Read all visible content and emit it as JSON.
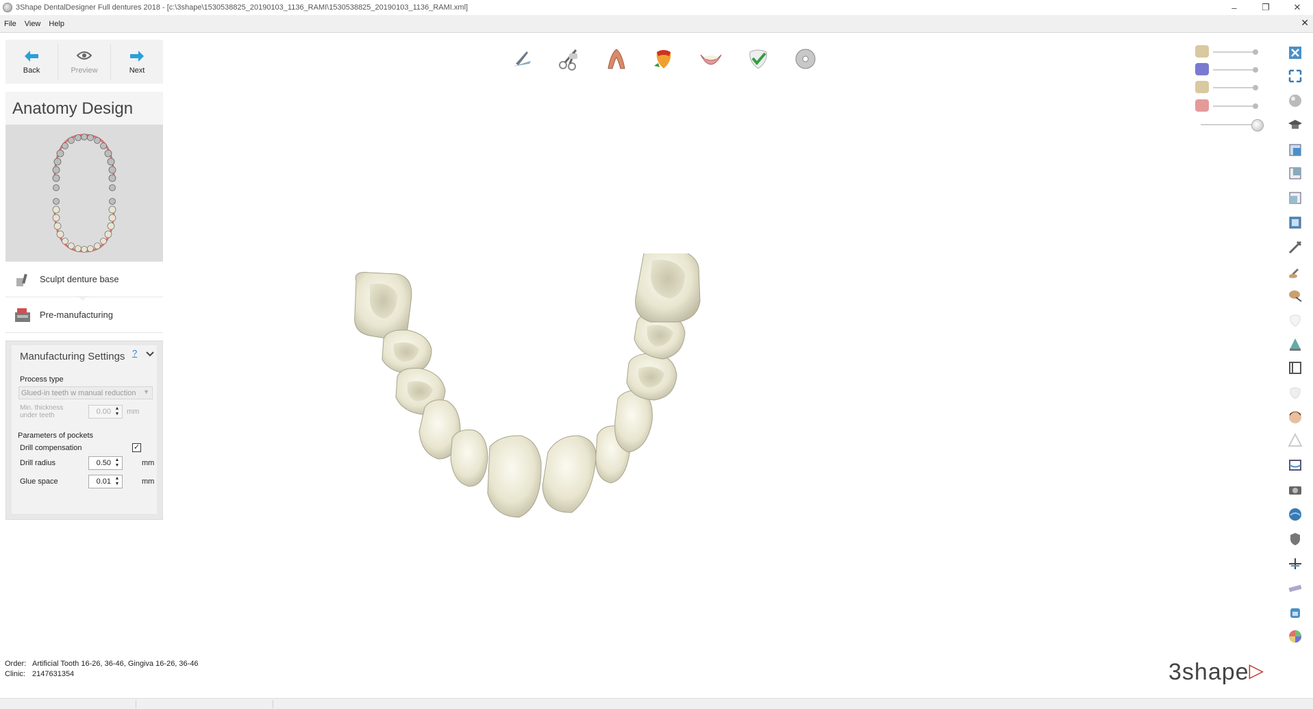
{
  "window": {
    "title": "3Shape DentalDesigner Full dentures 2018 - [c:\\3shape\\1530538825_20190103_1136_RAMI\\1530538825_20190103_1136_RAMI.xml]",
    "minimize": "–",
    "restore": "❐",
    "close": "✕"
  },
  "menu": {
    "file": "File",
    "view": "View",
    "help": "Help",
    "close": "✕"
  },
  "nav": {
    "back": "Back",
    "preview": "Preview",
    "next": "Next",
    "back_glyph": "➜",
    "preview_glyph": "👁",
    "next_glyph": "➜"
  },
  "phase": {
    "title": "Anatomy Design"
  },
  "steps": [
    {
      "label": "Sculpt denture base",
      "icon": "sculpt-tool-icon"
    },
    {
      "label": "Pre-manufacturing",
      "icon": "pre-manufacturing-icon"
    }
  ],
  "settings": {
    "header": "Manufacturing Settings",
    "help": "?",
    "collapse_glyph": "⌄",
    "process_type_label": "Process type",
    "process_type_value": "Glued-in teeth w manual reduction",
    "min_thickness_label_1": "Min. thickness",
    "min_thickness_label_2": "under teeth",
    "min_thickness_value": "0.00",
    "min_thickness_unit": "mm",
    "pockets_label": "Parameters of pockets",
    "drill_comp_label": "Drill compensation",
    "drill_comp_checked": "✓",
    "drill_radius_label": "Drill radius",
    "drill_radius_value": "0.50",
    "drill_radius_unit": "mm",
    "glue_space_label": "Glue space",
    "glue_space_value": "0.01",
    "glue_space_unit": "mm"
  },
  "toolbar_top": [
    "scalpel-icon",
    "scissors-icon",
    "tooth-root-icon",
    "tooth-color-icon",
    "gingiva-icon",
    "approve-icon",
    "disc-icon"
  ],
  "visibility": [
    {
      "icon": "upper-model-icon",
      "level": 1.0
    },
    {
      "icon": "scan-model-icon",
      "level": 1.0
    },
    {
      "icon": "lower-model-icon",
      "level": 1.0
    },
    {
      "icon": "gingiva-icon",
      "level": 1.0
    },
    {
      "icon": "teeth-icon",
      "level": 1.0
    }
  ],
  "toolbar_right": [
    "close-view-icon",
    "fit-view-icon",
    "sphere-view-icon",
    "graduation-cap-icon",
    "view-front-icon",
    "view-side-icon",
    "view-back-icon",
    "view-top-icon",
    "wax-knife-icon",
    "sculpt-add-icon",
    "sculpt-smooth-icon",
    "tooth-outline-icon",
    "cone-icon",
    "measure-icon",
    "tooth-faded-icon",
    "face-icon",
    "warning-icon",
    "crosssection-icon",
    "camera-icon",
    "color-sphere-icon",
    "shield-icon",
    "plane-icon",
    "ruler-icon",
    "scanner-icon",
    "color-wheel-icon"
  ],
  "order": {
    "order_key": "Order:",
    "order_value": "Artificial Tooth 16-26, 36-46, Gingiva 16-26, 36-46",
    "clinic_key": "Clinic:",
    "clinic_value": "2147631354"
  },
  "brand": {
    "logo": "3shape",
    "tri": "▷"
  },
  "colors": {
    "accent": "#2aa0d8",
    "tooth": "#ebe9d6",
    "gingiva": "#e07070"
  }
}
